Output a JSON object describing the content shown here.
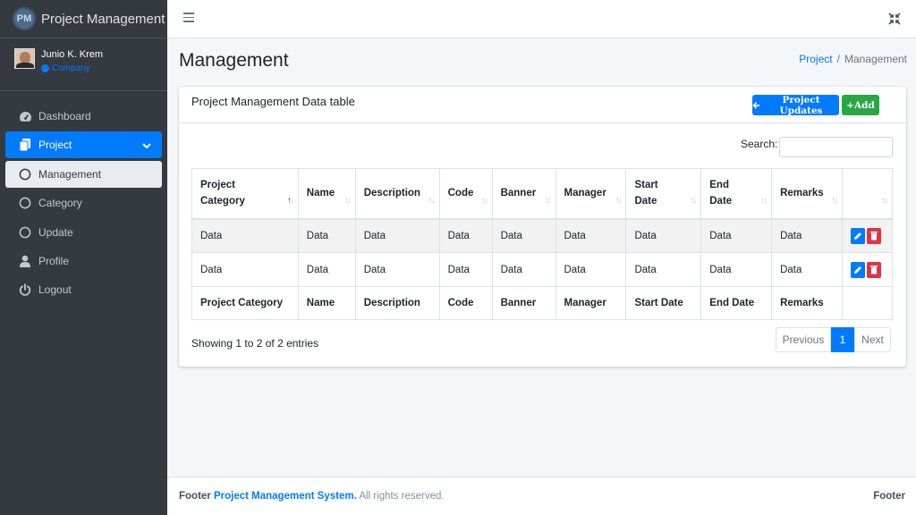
{
  "brand": {
    "title": "Project Management",
    "logo_text": "PM"
  },
  "user": {
    "name": "Junio K. Krem",
    "company": "Company"
  },
  "sidebar": {
    "items": [
      {
        "label": "Dashboard",
        "icon": "dashboard-icon"
      },
      {
        "label": "Project",
        "icon": "copy-icon",
        "active": true
      },
      {
        "label": "Management",
        "icon": "circle-icon",
        "sub_active": true
      },
      {
        "label": "Category",
        "icon": "circle-icon"
      },
      {
        "label": "Update",
        "icon": "circle-icon"
      },
      {
        "label": "Profile",
        "icon": "user-icon"
      },
      {
        "label": "Logout",
        "icon": "power-icon"
      }
    ]
  },
  "header": {
    "title": "Management",
    "breadcrumb": {
      "link": "Project",
      "separator": "/",
      "current": "Management"
    }
  },
  "card": {
    "title": "Project Management Data table",
    "updates_button": "Project Updates",
    "add_button": "+Add",
    "search_label": "Search:",
    "search_value": ""
  },
  "table": {
    "columns": [
      "Project\nCategory",
      "Name",
      "Description",
      "Code",
      "Banner",
      "Manager",
      "Start\nDate",
      "End\nDate",
      "Remarks",
      ""
    ],
    "footer_columns": [
      "Project Category",
      "Name",
      "Description",
      "Code",
      "Banner",
      "Manager",
      "Start Date",
      "End Date",
      "Remarks",
      ""
    ],
    "rows": [
      [
        "Data",
        "Data",
        "Data",
        "Data",
        "Data",
        "Data",
        "Data",
        "Data",
        "Data"
      ],
      [
        "Data",
        "Data",
        "Data",
        "Data",
        "Data",
        "Data",
        "Data",
        "Data",
        "Data"
      ]
    ]
  },
  "pagination": {
    "info": "Showing 1 to 2 of 2 entries",
    "previous": "Previous",
    "current": "1",
    "next": "Next"
  },
  "footer": {
    "prefix": "Footer",
    "system": "Project Management System.",
    "suffix": "All rights reserved.",
    "right": "Footer"
  },
  "colors": {
    "primary": "#007bff",
    "success": "#28a745",
    "danger": "#dc3545",
    "sidebar": "#343a40"
  }
}
